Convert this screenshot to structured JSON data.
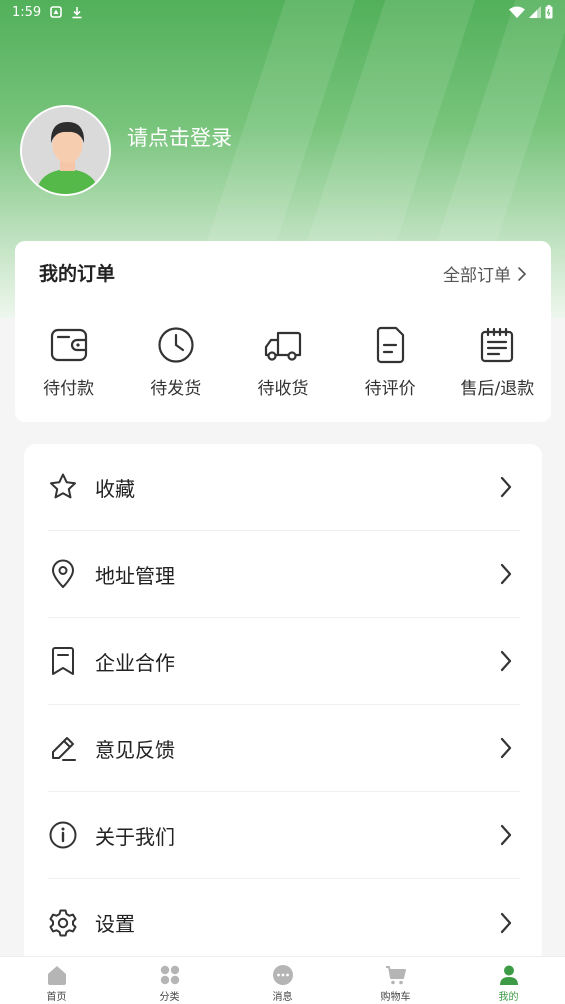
{
  "status_bar": {
    "time": "1:59",
    "left_icons": [
      "notification-icon",
      "download-icon"
    ],
    "right_icons": [
      "wifi-icon",
      "signal-icon",
      "battery-icon"
    ]
  },
  "profile": {
    "login_prompt": "请点击登录",
    "avatar": "user-avatar"
  },
  "orders": {
    "title": "我的订单",
    "view_all": "全部订单",
    "items": [
      {
        "label": "待付款",
        "icon": "wallet-icon"
      },
      {
        "label": "待发货",
        "icon": "clock-icon"
      },
      {
        "label": "待收货",
        "icon": "truck-icon"
      },
      {
        "label": "待评价",
        "icon": "document-icon"
      },
      {
        "label": "售后/退款",
        "icon": "notepad-icon"
      }
    ]
  },
  "menu": [
    {
      "label": "收藏",
      "icon": "star-icon"
    },
    {
      "label": "地址管理",
      "icon": "location-pin-icon"
    },
    {
      "label": "企业合作",
      "icon": "bookmark-icon"
    },
    {
      "label": "意见反馈",
      "icon": "pencil-icon"
    },
    {
      "label": "关于我们",
      "icon": "info-icon"
    },
    {
      "label": "设置",
      "icon": "gear-icon"
    }
  ],
  "tabs": [
    {
      "label": "首页",
      "icon": "home-icon"
    },
    {
      "label": "分类",
      "icon": "grid-icon"
    },
    {
      "label": "消息",
      "icon": "message-icon"
    },
    {
      "label": "购物车",
      "icon": "cart-icon"
    },
    {
      "label": "我的",
      "icon": "person-icon",
      "active": true
    }
  ],
  "colors": {
    "brand_green": "#4caf50",
    "active_tab": "#3c9b44",
    "tab_inactive": "#b5b5b5"
  }
}
